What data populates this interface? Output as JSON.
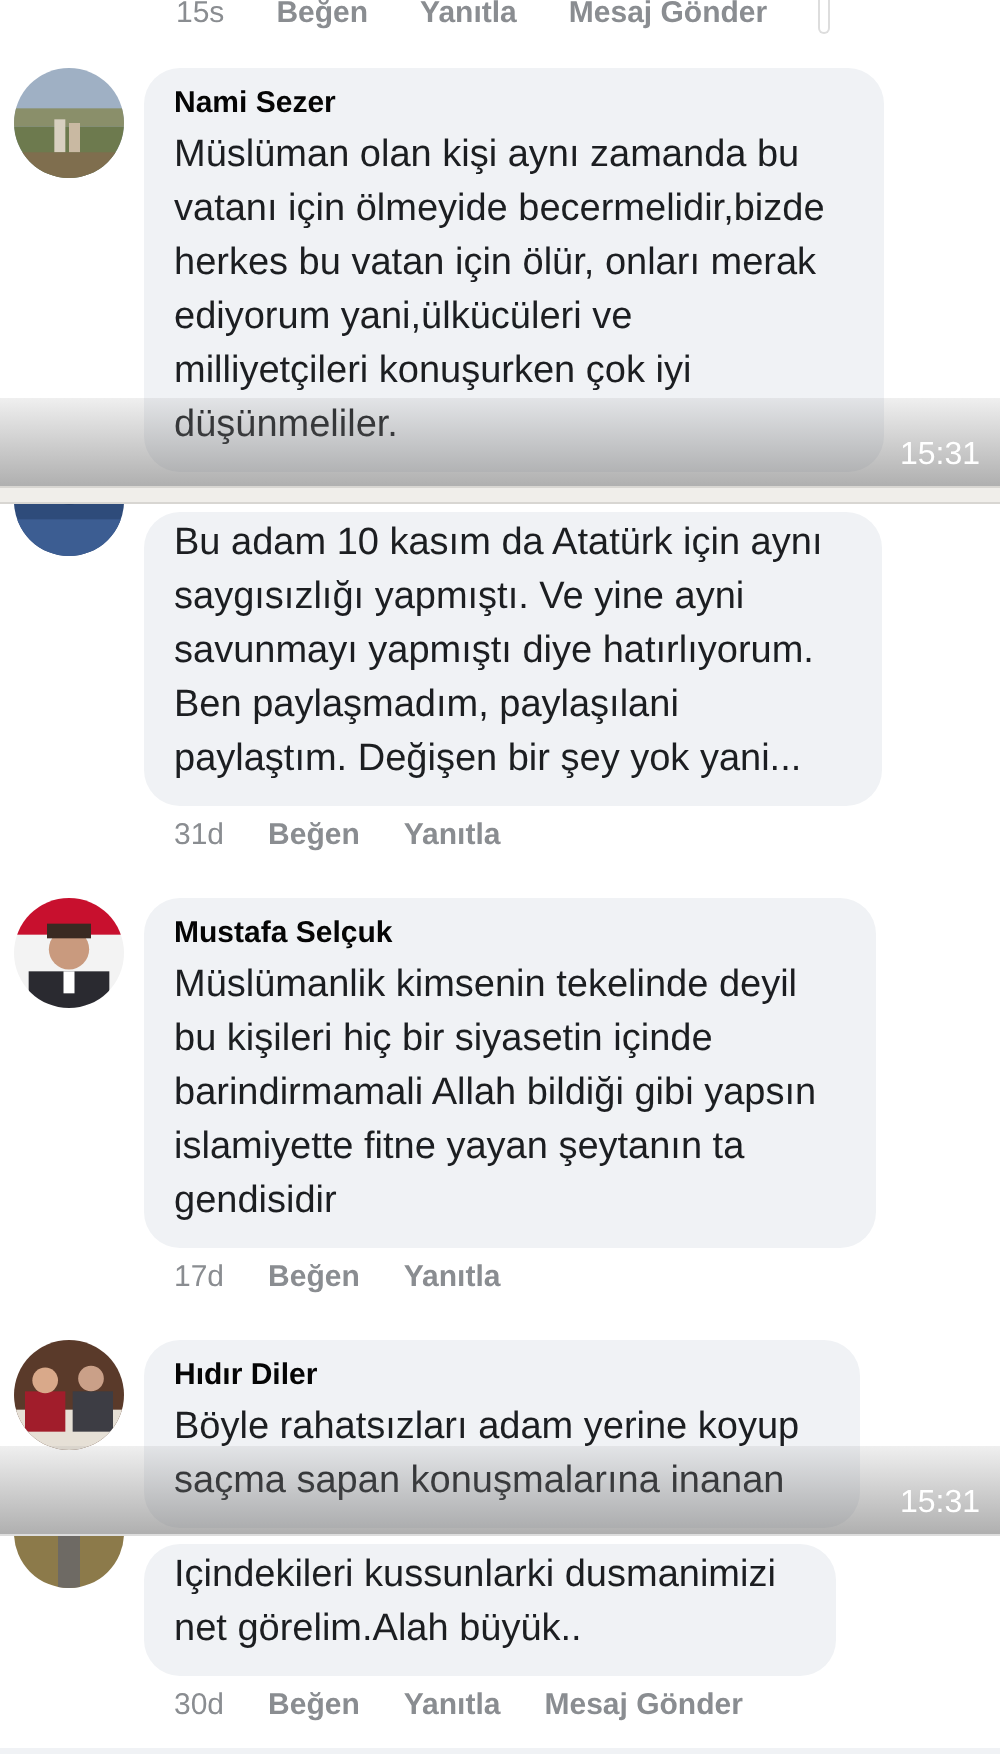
{
  "fragments": [
    {
      "top_meta": {
        "time": "15s",
        "actions": [
          "Beğen",
          "Yanıtla",
          "Mesaj Gönder"
        ]
      },
      "time_overlay": "15:31",
      "comments": [
        {
          "author": "Nami Sezer",
          "text": "Müslüman olan kişi aynı zamanda bu\nvatanı için ölmeyide becermelidir,bizde\nherkes bu vatan için ölür, onları merak\nediyorum yani,ülkücüleri ve\nmilliyetçileri konuşurken çok iyi\ndüşünmeliler."
        }
      ]
    },
    {
      "time_overlay": "15:31",
      "comments": [
        {
          "text": "Bu adam 10 kasım da Atatürk için aynı\nsaygısızlığı yapmıştı. Ve yine ayni\nsavunmayı yapmıştı diye hatırlıyorum.\nBen paylaşmadım, paylaşılani\npaylaştım. Değişen bir şey yok yani...",
          "time": "31d",
          "actions": [
            "Beğen",
            "Yanıtla"
          ]
        },
        {
          "author": "Mustafa Selçuk",
          "text": "Müslümanlik kimsenin tekelinde deyil\nbu kişileri hiç bir siyasetin içinde\nbarindirmamali Allah bildiği gibi yapsın\nislamiyette fitne yayan şeytanın ta\ngendisidir",
          "time": "17d",
          "actions": [
            "Beğen",
            "Yanıtla"
          ]
        },
        {
          "author": "Hıdır Diler",
          "text": "Böyle rahatsızları adam yerine koyup\nsaçma sapan konuşmalarına inanan"
        }
      ]
    },
    {
      "comments": [
        {
          "text": "Içindekileri kussunlarki dusmanimizi\nnet görelim.Alah büyük..",
          "time": "30d",
          "actions": [
            "Beğen",
            "Yanıtla",
            "Mesaj Gönder"
          ]
        }
      ]
    }
  ]
}
